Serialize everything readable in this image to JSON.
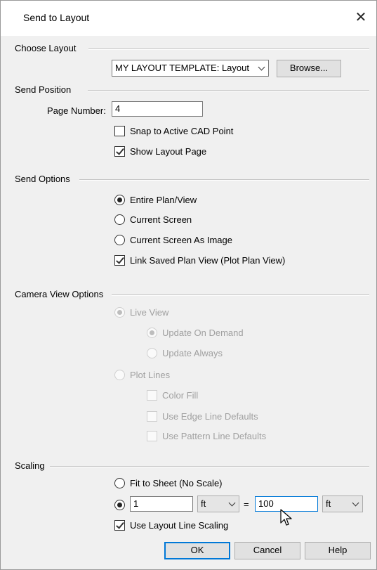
{
  "window": {
    "title": "Send to Layout",
    "close_glyph": "✕"
  },
  "choose_layout": {
    "label": "Choose Layout",
    "layout_select": "MY LAYOUT TEMPLATE: Layout",
    "browse_label": "Browse..."
  },
  "send_position": {
    "label": "Send Position",
    "page_number_label": "Page Number:",
    "page_number_value": "4",
    "snap_label": "Snap to Active CAD Point",
    "snap_checked": false,
    "show_layout_label": "Show Layout Page",
    "show_layout_checked": true
  },
  "send_options": {
    "label": "Send Options",
    "entire_plan": "Entire Plan/View",
    "current_screen": "Current Screen",
    "current_screen_image": "Current Screen As Image",
    "selected": "Entire Plan/View",
    "link_saved": "Link Saved Plan View (Plot Plan View)",
    "link_saved_checked": true
  },
  "camera_view_options": {
    "label": "Camera View Options",
    "live_view": "Live View",
    "update_on_demand": "Update On Demand",
    "update_always": "Update Always",
    "plot_lines": "Plot Lines",
    "color_fill": "Color Fill",
    "use_edge_line_defaults": "Use Edge Line Defaults",
    "use_pattern_line_defaults": "Use Pattern Line Defaults",
    "enabled": false
  },
  "scaling": {
    "label": "Scaling",
    "fit_to_sheet": "Fit to Sheet (No Scale)",
    "scale_left_value": "1",
    "scale_left_unit": "ft",
    "equals": "=",
    "scale_right_value": "100",
    "scale_right_unit": "ft",
    "use_layout_line_scaling": "Use Layout Line Scaling",
    "use_layout_line_scaling_checked": true
  },
  "buttons": {
    "ok": "OK",
    "cancel": "Cancel",
    "help": "Help"
  },
  "colors": {
    "focus_accent": "#0078d7",
    "dialog_bg": "#f0f0f0"
  },
  "icons": [
    "close-icon",
    "chevron-down-icon",
    "mouse-cursor-icon"
  ]
}
